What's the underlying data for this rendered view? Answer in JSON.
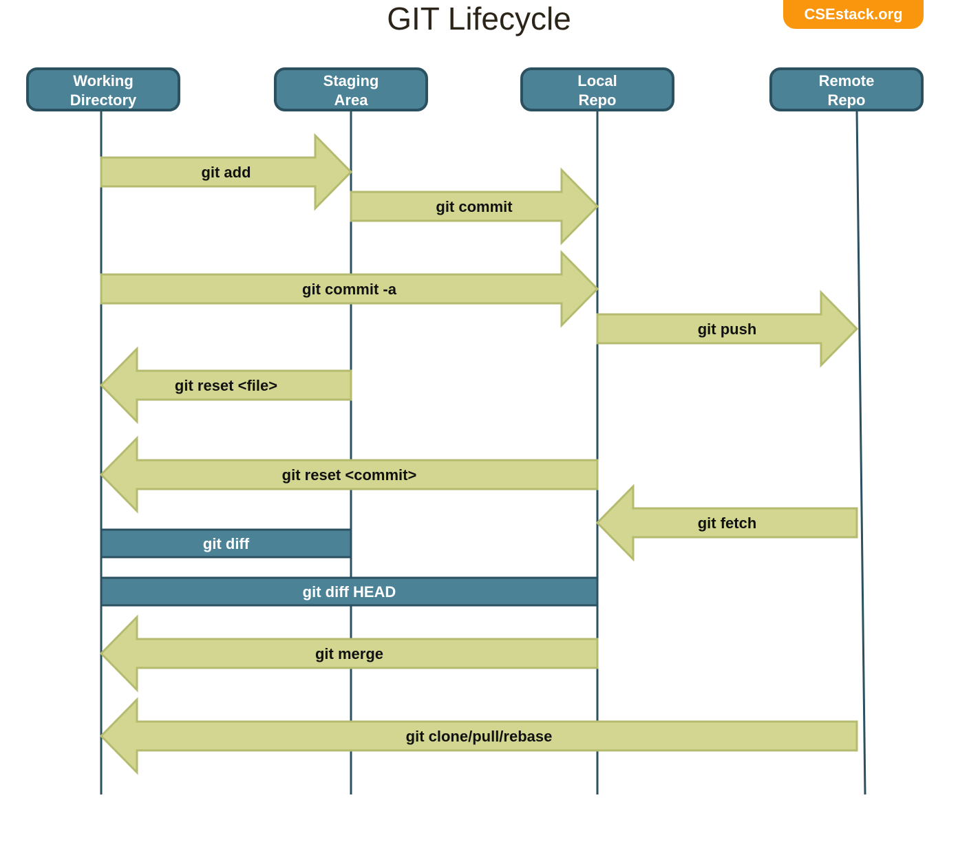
{
  "title": "GIT Lifecycle",
  "badge": "CSEstack.org",
  "colors": {
    "header_fill": "#4c8296",
    "header_stroke": "#2b5161",
    "lifeline": "#2b5161",
    "arrow_fill": "#d2d690",
    "arrow_stroke": "#b4bb6e",
    "diff_fill": "#4c8296",
    "diff_stroke": "#2b5161",
    "badge": "#f9960e",
    "title": "#2b2418"
  },
  "lanes": [
    {
      "id": "working",
      "line1": "Working",
      "line2": "Directory"
    },
    {
      "id": "staging",
      "line1": "Staging",
      "line2": "Area"
    },
    {
      "id": "local",
      "line1": "Local",
      "line2": "Repo"
    },
    {
      "id": "remote",
      "line1": "Remote",
      "line2": "Repo"
    }
  ],
  "commands": [
    {
      "label": "git add",
      "from": 0,
      "to": 1,
      "kind": "arrow"
    },
    {
      "label": "git commit",
      "from": 1,
      "to": 2,
      "kind": "arrow"
    },
    {
      "label": "git commit -a",
      "from": 0,
      "to": 2,
      "kind": "arrow"
    },
    {
      "label": "git push",
      "from": 2,
      "to": 3,
      "kind": "arrow"
    },
    {
      "label": "git reset <file>",
      "from": 1,
      "to": 0,
      "kind": "arrow"
    },
    {
      "label": "git reset <commit>",
      "from": 2,
      "to": 0,
      "kind": "arrow"
    },
    {
      "label": "git fetch",
      "from": 3,
      "to": 2,
      "kind": "arrow"
    },
    {
      "label": "git diff",
      "from": 0,
      "to": 1,
      "kind": "bar"
    },
    {
      "label": "git diff HEAD",
      "from": 0,
      "to": 2,
      "kind": "bar"
    },
    {
      "label": "git merge",
      "from": 2,
      "to": 0,
      "kind": "arrow"
    },
    {
      "label": "git clone/pull/rebase",
      "from": 3,
      "to": 0,
      "kind": "arrow"
    }
  ]
}
